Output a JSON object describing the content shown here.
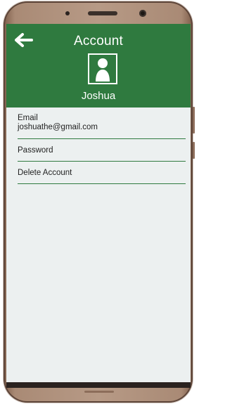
{
  "header": {
    "title": "Account",
    "user_name": "Joshua"
  },
  "icons": {
    "back": "arrow-left-icon",
    "avatar": "user-avatar-icon"
  },
  "list": {
    "email_label": "Email",
    "email_value": "joshuathe@gmail.com",
    "password_label": "Password",
    "delete_label": "Delete Account"
  },
  "colors": {
    "header_green": "#2f7a3f",
    "screen_bg": "#ecf0f0",
    "divider": "#2f7a3f",
    "device_frame": "#b79a86"
  }
}
